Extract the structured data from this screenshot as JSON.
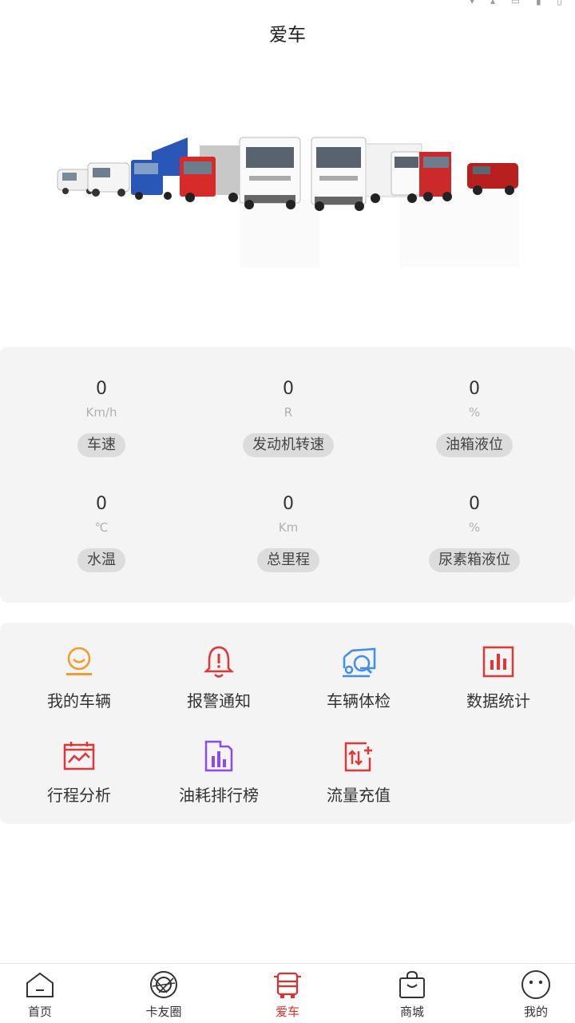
{
  "header": {
    "title": "爱车"
  },
  "stats": [
    {
      "value": "0",
      "unit": "Km/h",
      "label": "车速"
    },
    {
      "value": "0",
      "unit": "R",
      "label": "发动机转速"
    },
    {
      "value": "0",
      "unit": "%",
      "label": "油箱液位"
    },
    {
      "value": "0",
      "unit": "℃",
      "label": "水温"
    },
    {
      "value": "0",
      "unit": "Km",
      "label": "总里程"
    },
    {
      "value": "0",
      "unit": "%",
      "label": "尿素箱液位"
    }
  ],
  "menu": [
    {
      "label": "我的车辆",
      "icon": "my-vehicle-icon",
      "color": "#f29a2e"
    },
    {
      "label": "报警通知",
      "icon": "alarm-bell-icon",
      "color": "#e03636"
    },
    {
      "label": "车辆体检",
      "icon": "vehicle-check-icon",
      "color": "#3d8ef0"
    },
    {
      "label": "数据统计",
      "icon": "bar-chart-icon",
      "color": "#e03636"
    },
    {
      "label": "行程分析",
      "icon": "trip-analysis-icon",
      "color": "#e03636"
    },
    {
      "label": "油耗排行榜",
      "icon": "fuel-ranking-icon",
      "color": "#8a4cf0"
    },
    {
      "label": "流量充值",
      "icon": "data-recharge-icon",
      "color": "#e03636"
    }
  ],
  "tabs": [
    {
      "label": "首页",
      "icon": "home-icon"
    },
    {
      "label": "卡友圈",
      "icon": "circle-icon"
    },
    {
      "label": "爱车",
      "icon": "truck-icon",
      "active": true
    },
    {
      "label": "商城",
      "icon": "shopping-bag-icon"
    },
    {
      "label": "我的",
      "icon": "profile-face-icon"
    }
  ],
  "colors": {
    "accent": "#e02e2e",
    "card_bg": "#f4f4f4",
    "pill_bg": "#dcdcdc"
  }
}
